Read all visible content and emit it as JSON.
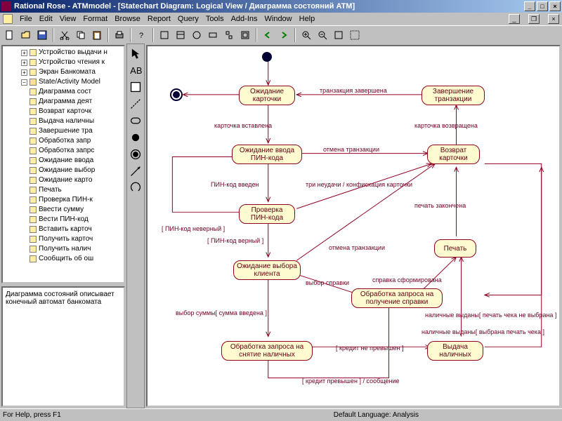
{
  "window": {
    "title": "Rational Rose - ATMmodel - [Statechart Diagram: Logical View / Диаграмма состояний ATM]"
  },
  "menu": {
    "file": "File",
    "edit": "Edit",
    "view": "View",
    "format": "Format",
    "browse": "Browse",
    "report": "Report",
    "query": "Query",
    "tools": "Tools",
    "addins": "Add-Ins",
    "window": "Window",
    "help": "Help"
  },
  "tree": {
    "n0": "Устройство выдачи н",
    "n1": "Устройство чтения к",
    "n2": "Экран Банкомата",
    "n3": "State/Activity Model",
    "n4": "Диаграмма сост",
    "n5": "Диаграмма деят",
    "n6": "Возврат карточк",
    "n7": "Выдача наличны",
    "n8": "Завершение тра",
    "n9": "Обработка запр",
    "n10": "Обработка запрс",
    "n11": "Ожидание ввода",
    "n12": "Ожидание выбор",
    "n13": "Ожидание карто",
    "n14": "Печать",
    "n15": "Проверка ПИН-к",
    "n16": "Ввести сумму",
    "n17": "Вести ПИН-код",
    "n18": "Вставить карточ",
    "n19": "Получить карточ",
    "n20": "Получить налич",
    "n21": "Сообщить об ош"
  },
  "desc": {
    "text": "Диаграмма состояний описывает конечный автомат банкомата"
  },
  "states": {
    "s1": "Ожидание\nкарточки",
    "s2": "Завершение\nтранзакции",
    "s3": "Ожидание ввода\nПИН-кода",
    "s4": "Возврат\nкарточки",
    "s5": "Проверка\nПИН-кода",
    "s6": "Ожидание\nвыбора клиента",
    "s7": "Печать",
    "s8": "Обработка запроса на\nполучение справки",
    "s9": "Обработка запроса\nна снятие наличных",
    "s10": "Выдача\nналичных"
  },
  "labels": {
    "l1": "транзакция завершена",
    "l2": "карточка вставлена",
    "l3": "карточка возвращена",
    "l4": "отмена транзакции",
    "l5": "ПИН-код введен",
    "l6": "три неудачи / конфискация карточки",
    "l7": "[ ПИН-код неверный ]",
    "l8": "[ ПИН-код верный ]",
    "l9": "печать закончена",
    "l10": "отмена транзакции",
    "l11": "выбор справки",
    "l12": "справка сформирована",
    "l13": "выбор суммы[ сумма введена ]",
    "l14": "наличные выданы[ печать чека не выбрана ]",
    "l15": "[ кредит не превышен ]",
    "l16": "наличные выданы[ выбрана печать чека ]",
    "l17": "[ кредит превышен ] / сообщение"
  },
  "status": {
    "help": "For Help, press F1",
    "lang": "Default Language: Analysis"
  }
}
